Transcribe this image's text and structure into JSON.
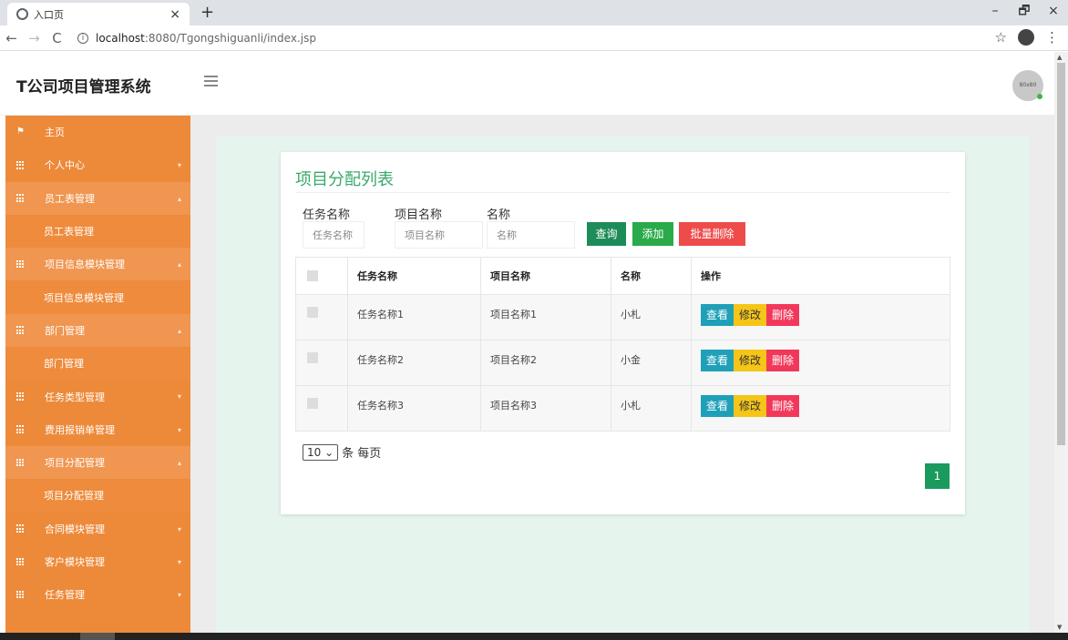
{
  "browser": {
    "tab_title": "入口页",
    "tab_close": "×",
    "new_tab": "+",
    "win_min": "–",
    "win_max": "🗗",
    "win_close": "×",
    "back": "←",
    "forward": "→",
    "reload": "C",
    "url_host": "localhost",
    "url_port_path": ":8080/Tgongshiguanli/index.jsp",
    "star": "☆",
    "menu": "⋮"
  },
  "header": {
    "title": "T公司项目管理系统",
    "avatar_text": "80x80"
  },
  "sidebar": {
    "items": [
      {
        "label": "主页",
        "icon": "flag-icon"
      },
      {
        "label": "个人中心",
        "icon": "grid-icon",
        "arrow": "▾"
      },
      {
        "label": "员工表管理",
        "icon": "grid-icon",
        "arrow": "▴"
      },
      {
        "label": "员工表管理",
        "sub": true
      },
      {
        "label": "项目信息模块管理",
        "icon": "grid-icon",
        "arrow": "▴"
      },
      {
        "label": "项目信息模块管理",
        "sub": true
      },
      {
        "label": "部门管理",
        "icon": "grid-icon",
        "arrow": "▴"
      },
      {
        "label": "部门管理",
        "sub": true
      },
      {
        "label": "任务类型管理",
        "icon": "grid-icon",
        "arrow": "▾"
      },
      {
        "label": "费用报销单管理",
        "icon": "grid-icon",
        "arrow": "▾"
      },
      {
        "label": "项目分配管理",
        "icon": "grid-icon",
        "arrow": "▴"
      },
      {
        "label": "项目分配管理",
        "sub": true
      },
      {
        "label": "合同模块管理",
        "icon": "grid-icon",
        "arrow": "▾"
      },
      {
        "label": "客户模块管理",
        "icon": "grid-icon",
        "arrow": "▾"
      },
      {
        "label": "任务管理",
        "icon": "grid-icon",
        "arrow": "▾"
      }
    ]
  },
  "main": {
    "card_title": "项目分配列表",
    "search": {
      "task_label": "任务名称",
      "task_placeholder": "任务名称",
      "project_label": "项目名称",
      "project_placeholder": "项目名称",
      "name_label": "名称",
      "name_placeholder": "名称",
      "query_btn": "查询",
      "add_btn": "添加",
      "batch_delete_btn": "批量删除"
    },
    "table": {
      "headers": [
        "任务名称",
        "项目名称",
        "名称",
        "操作"
      ],
      "rows": [
        {
          "task": "任务名称1",
          "project": "项目名称1",
          "name": "小札"
        },
        {
          "task": "任务名称2",
          "project": "项目名称2",
          "name": "小金"
        },
        {
          "task": "任务名称3",
          "project": "项目名称3",
          "name": "小札"
        }
      ],
      "view_btn": "查看",
      "edit_btn": "修改",
      "delete_btn": "删除"
    },
    "pager": {
      "page_size": "10",
      "page_size_suffix": "条 每页",
      "current_page": "1"
    }
  },
  "colors": {
    "sidebar": "#ed8a3a",
    "accent_green": "#3aa96a",
    "panel_bg": "#e6f4ee"
  }
}
